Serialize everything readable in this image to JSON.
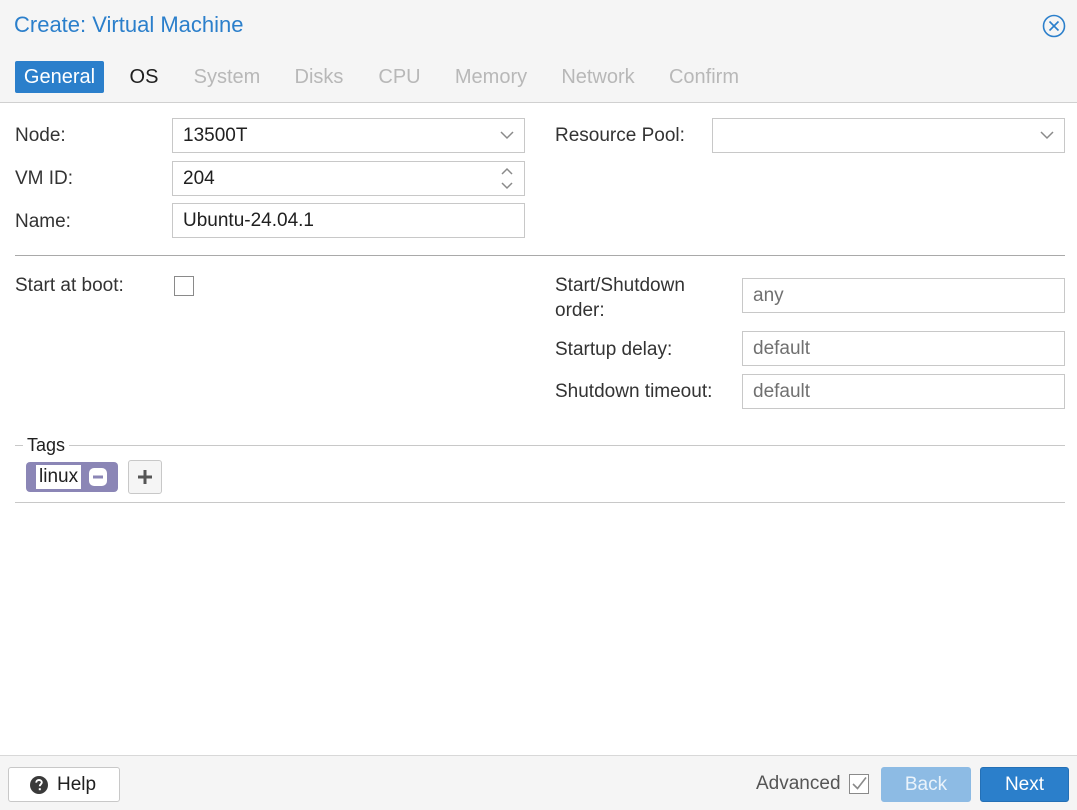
{
  "window": {
    "title": "Create: Virtual Machine"
  },
  "tabs": [
    {
      "label": "General",
      "state": "active"
    },
    {
      "label": "OS",
      "state": "enabled"
    },
    {
      "label": "System",
      "state": "disabled"
    },
    {
      "label": "Disks",
      "state": "disabled"
    },
    {
      "label": "CPU",
      "state": "disabled"
    },
    {
      "label": "Memory",
      "state": "disabled"
    },
    {
      "label": "Network",
      "state": "disabled"
    },
    {
      "label": "Confirm",
      "state": "disabled"
    }
  ],
  "form": {
    "node": {
      "label": "Node:",
      "value": "13500T"
    },
    "vmid": {
      "label": "VM ID:",
      "value": "204"
    },
    "name": {
      "label": "Name:",
      "value": "Ubuntu-24.04.1"
    },
    "pool": {
      "label": "Resource Pool:",
      "value": ""
    },
    "start_at_boot": {
      "label": "Start at boot:",
      "checked": false
    },
    "order": {
      "label_line1": "Start/Shutdown",
      "label_line2": "order:",
      "placeholder": "any"
    },
    "startup_delay": {
      "label": "Startup delay:",
      "placeholder": "default"
    },
    "shutdown_timeout": {
      "label": "Shutdown timeout:",
      "placeholder": "default"
    }
  },
  "tags": {
    "legend": "Tags",
    "items": [
      "linux"
    ]
  },
  "footer": {
    "help_label": "Help",
    "advanced_label": "Advanced",
    "advanced_checked": true,
    "back_label": "Back",
    "next_label": "Next"
  },
  "colors": {
    "accent": "#2b7fcb",
    "tag": "#8b86b6"
  }
}
